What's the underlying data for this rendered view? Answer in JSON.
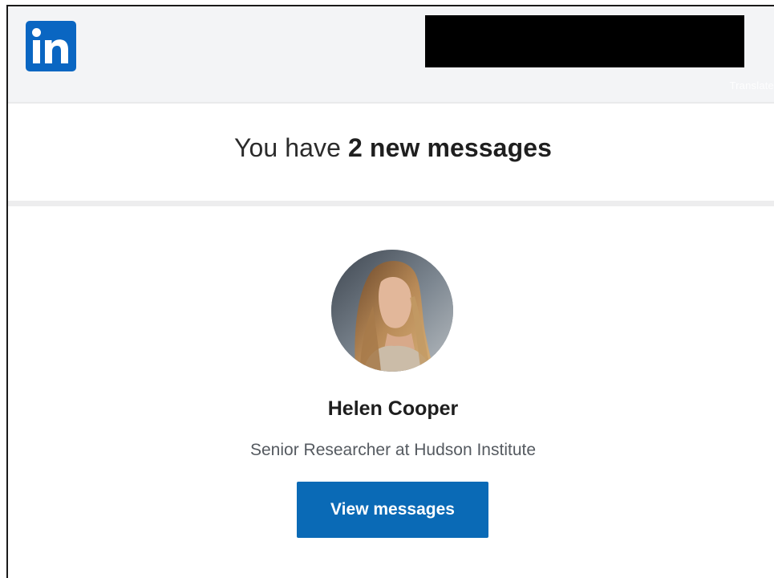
{
  "brand": {
    "logo_icon": "linkedin-logo-icon",
    "logo_color": "#0a66c2"
  },
  "header": {
    "faint_text": "Translate"
  },
  "headline": {
    "prefix": "You have ",
    "emphasis": "2 new messages"
  },
  "sender": {
    "name": "Helen Cooper",
    "title": "Senior Researcher at Hudson Institute",
    "avatar_icon": "profile-photo"
  },
  "cta": {
    "label": "View messages",
    "color": "#0a6ab6"
  }
}
